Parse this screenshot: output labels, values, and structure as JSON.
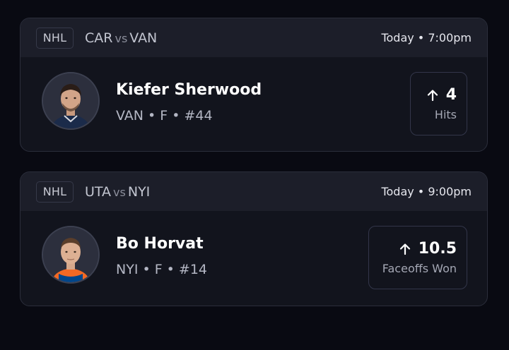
{
  "picks": [
    {
      "league": "NHL",
      "away_team": "CAR",
      "vs_label": "vs",
      "home_team": "VAN",
      "game_time": "Today • 7:00pm",
      "player_name": "Kiefer Sherwood",
      "player_meta": "VAN • F • #44",
      "stat_direction": "up-arrow-icon",
      "stat_value": "4",
      "stat_label": "Hits",
      "jersey_color": "#1b2b4a"
    },
    {
      "league": "NHL",
      "away_team": "UTA",
      "vs_label": "vs",
      "home_team": "NYI",
      "game_time": "Today • 9:00pm",
      "player_name": "Bo Horvat",
      "player_meta": "NYI • F • #14",
      "stat_direction": "up-arrow-icon",
      "stat_value": "10.5",
      "stat_label": "Faceoffs Won",
      "jersey_color": "#f26924"
    }
  ]
}
